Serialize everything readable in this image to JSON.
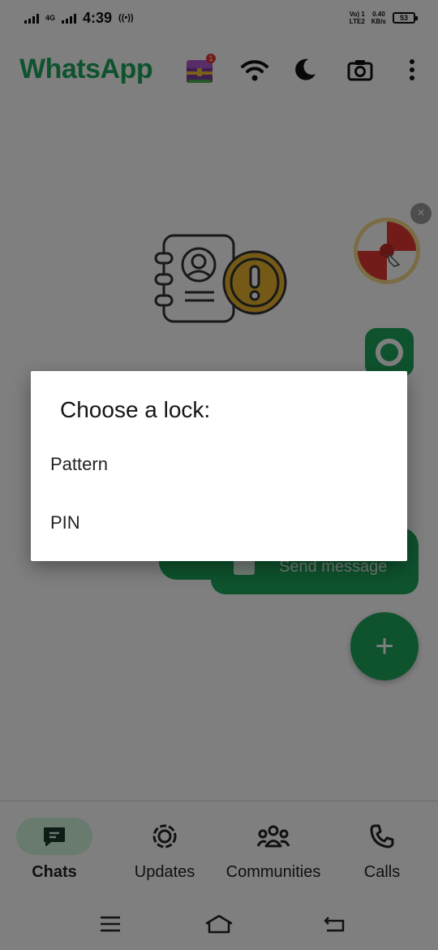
{
  "status_bar": {
    "network_type": "4G",
    "time": "4:39",
    "hotspot": "((•))",
    "volte": "Vo) 1\nLTE2",
    "speed_value": "0.40",
    "speed_unit": "KB/s",
    "battery": "53"
  },
  "app_bar": {
    "title": "WhatsApp",
    "icons": [
      "treasure-chest-icon",
      "wifi-icon",
      "moon-icon",
      "camera-icon",
      "more-vert-icon"
    ],
    "badge_count": "1"
  },
  "main": {
    "send_message_label": "Send message",
    "new_chat_label": "+",
    "close_label": "×"
  },
  "dialog": {
    "title": "Choose a lock:",
    "options": [
      "Pattern",
      "PIN"
    ]
  },
  "bottom_nav": {
    "items": [
      {
        "label": "Chats",
        "icon": "chat-icon",
        "active": true
      },
      {
        "label": "Updates",
        "icon": "updates-icon",
        "active": false
      },
      {
        "label": "Communities",
        "icon": "communities-icon",
        "active": false
      },
      {
        "label": "Calls",
        "icon": "phone-icon",
        "active": false
      }
    ]
  },
  "system_nav": {
    "icons": [
      "menu-icon",
      "home-icon",
      "back-icon"
    ]
  },
  "colors": {
    "brand_green": "#1da65a",
    "active_pill": "#d3f5dd",
    "scrim": "rgba(0,0,0,0.5)"
  }
}
